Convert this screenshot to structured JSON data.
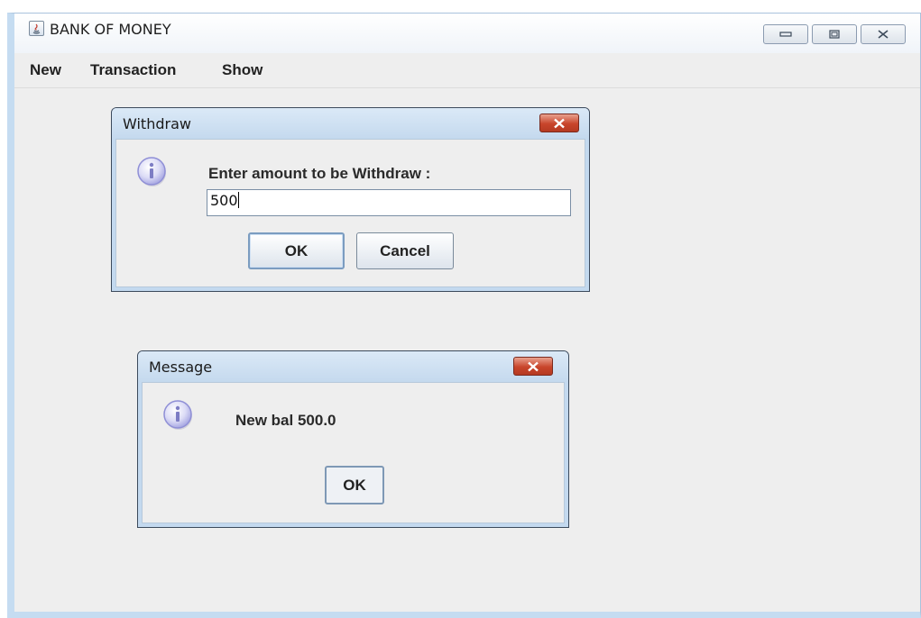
{
  "app": {
    "title": "BANK OF MONEY"
  },
  "menubar": {
    "items": [
      {
        "label": "New"
      },
      {
        "label": "Transaction"
      },
      {
        "label": "Show"
      }
    ]
  },
  "withdraw_dialog": {
    "title": "Withdraw",
    "prompt": "Enter amount to be Withdraw :",
    "input_value": "500",
    "ok_label": "OK",
    "cancel_label": "Cancel",
    "icon": "info-icon"
  },
  "message_dialog": {
    "title": "Message",
    "message": "New bal 500.0",
    "ok_label": "OK",
    "icon": "info-icon"
  },
  "colors": {
    "window_background": "#eeeeee",
    "close_button": "#c8452b",
    "dialog_frame": "#c3d9ef",
    "info_icon": "#8f8fd6"
  }
}
